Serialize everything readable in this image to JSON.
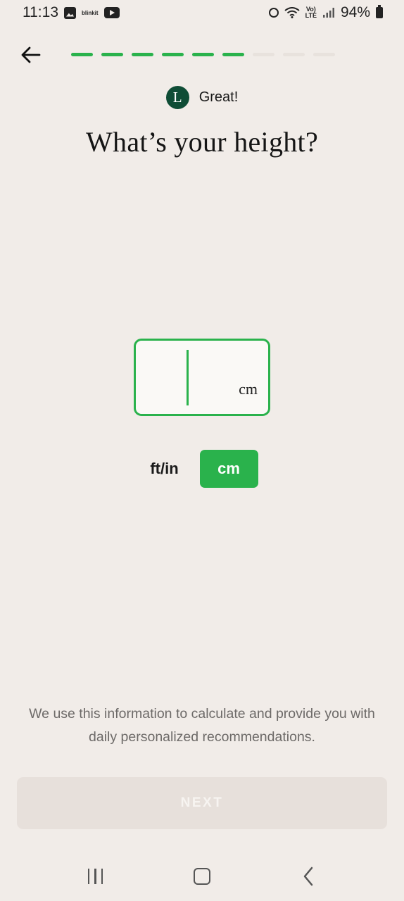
{
  "status_bar": {
    "time": "11:13",
    "notification_app": "blinkit",
    "battery": "94%",
    "volte": "Vo)\nLTE"
  },
  "header": {
    "back_icon": "arrow-left-icon",
    "progress": {
      "completed": 6,
      "total": 9
    }
  },
  "coach": {
    "avatar_letter": "L",
    "message": "Great!"
  },
  "question": {
    "title": "What’s your height?"
  },
  "height_input": {
    "value": "",
    "unit": "cm"
  },
  "unit_toggle": {
    "options": [
      "ft/in",
      "cm"
    ],
    "selected": "cm"
  },
  "info": {
    "text": "We use this information to calculate and provide you with daily personalized recommendations."
  },
  "footer": {
    "next_label": "NEXT",
    "next_enabled": false
  },
  "colors": {
    "accent": "#2ab24c",
    "background": "#f1ece8",
    "avatar": "#0f4d36",
    "disabled_button": "#e7e0db"
  }
}
